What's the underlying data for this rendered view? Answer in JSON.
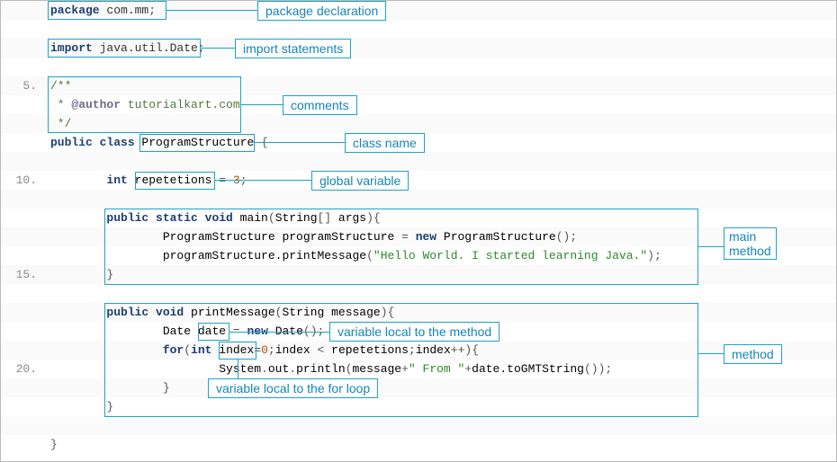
{
  "code": {
    "lines": [
      {
        "n": "",
        "tokens": [
          [
            "kw",
            "package"
          ],
          [
            "pkg",
            " com.mm"
          ],
          [
            "punct",
            ";"
          ]
        ]
      },
      {
        "n": "",
        "tokens": []
      },
      {
        "n": "",
        "tokens": [
          [
            "kw",
            "import"
          ],
          [
            "pkg",
            " java.util.Date"
          ],
          [
            "punct",
            ";"
          ]
        ]
      },
      {
        "n": "",
        "tokens": []
      },
      {
        "n": "5.",
        "tokens": [
          [
            "com",
            "/**"
          ]
        ]
      },
      {
        "n": "",
        "tokens": [
          [
            "com",
            " * "
          ],
          [
            "ann",
            "@author"
          ],
          [
            "com",
            " tutorialkart.com"
          ]
        ]
      },
      {
        "n": "",
        "tokens": [
          [
            "com",
            " */"
          ]
        ]
      },
      {
        "n": "",
        "tokens": [
          [
            "kw",
            "public "
          ],
          [
            "kw",
            "class "
          ],
          [
            "cls",
            "ProgramStructure"
          ],
          [
            "punct",
            " {"
          ]
        ]
      },
      {
        "n": "",
        "tokens": []
      },
      {
        "n": "10.",
        "tokens": [
          [
            "id",
            "        "
          ],
          [
            "kw",
            "int "
          ],
          [
            "id",
            "repetetions"
          ],
          [
            "punct",
            " = "
          ],
          [
            "num",
            "3"
          ],
          [
            "punct",
            ";"
          ]
        ]
      },
      {
        "n": "",
        "tokens": []
      },
      {
        "n": "",
        "tokens": [
          [
            "id",
            "        "
          ],
          [
            "kw",
            "public "
          ],
          [
            "kw",
            "static "
          ],
          [
            "kw",
            "void "
          ],
          [
            "id",
            "main"
          ],
          [
            "punct",
            "("
          ],
          [
            "cls",
            "String"
          ],
          [
            "punct",
            "[] "
          ],
          [
            "id",
            "args"
          ],
          [
            "punct",
            "){"
          ]
        ]
      },
      {
        "n": "",
        "tokens": [
          [
            "id",
            "                "
          ],
          [
            "cls",
            "ProgramStructure"
          ],
          [
            "id",
            " programStructure"
          ],
          [
            "punct",
            " = "
          ],
          [
            "kw",
            "new "
          ],
          [
            "cls",
            "ProgramStructure"
          ],
          [
            "punct",
            "();"
          ]
        ]
      },
      {
        "n": "",
        "tokens": [
          [
            "id",
            "                "
          ],
          [
            "id",
            "programStructure.printMessage"
          ],
          [
            "punct",
            "("
          ],
          [
            "str",
            "\"Hello World. I started learning Java.\""
          ],
          [
            "punct",
            ");"
          ]
        ]
      },
      {
        "n": "15.",
        "tokens": [
          [
            "id",
            "        "
          ],
          [
            "punct",
            "}"
          ]
        ]
      },
      {
        "n": "",
        "tokens": []
      },
      {
        "n": "",
        "tokens": [
          [
            "id",
            "        "
          ],
          [
            "kw",
            "public "
          ],
          [
            "kw",
            "void "
          ],
          [
            "id",
            "printMessage"
          ],
          [
            "punct",
            "("
          ],
          [
            "cls",
            "String"
          ],
          [
            "id",
            " message"
          ],
          [
            "punct",
            "){"
          ]
        ]
      },
      {
        "n": "",
        "tokens": [
          [
            "id",
            "                "
          ],
          [
            "cls",
            "Date "
          ],
          [
            "id",
            "date"
          ],
          [
            "punct",
            " = "
          ],
          [
            "kw",
            "new "
          ],
          [
            "cls",
            "Date"
          ],
          [
            "punct",
            "();"
          ]
        ]
      },
      {
        "n": "",
        "tokens": [
          [
            "id",
            "                "
          ],
          [
            "kw",
            "for"
          ],
          [
            "punct",
            "("
          ],
          [
            "kw",
            "int "
          ],
          [
            "id",
            "index"
          ],
          [
            "punct",
            "="
          ],
          [
            "num",
            "0"
          ],
          [
            "punct",
            ";"
          ],
          [
            "id",
            "index"
          ],
          [
            "punct",
            " < "
          ],
          [
            "id",
            "repetetions"
          ],
          [
            "punct",
            ";"
          ],
          [
            "id",
            "index"
          ],
          [
            "punct",
            "++){"
          ]
        ]
      },
      {
        "n": "20.",
        "tokens": [
          [
            "id",
            "                        "
          ],
          [
            "cls",
            "System"
          ],
          [
            "punct",
            "."
          ],
          [
            "id",
            "out"
          ],
          [
            "punct",
            "."
          ],
          [
            "id",
            "println"
          ],
          [
            "punct",
            "("
          ],
          [
            "id",
            "message"
          ],
          [
            "punct",
            "+"
          ],
          [
            "str",
            "\" From \""
          ],
          [
            "punct",
            "+"
          ],
          [
            "id",
            "date.toGMTString"
          ],
          [
            "punct",
            "());"
          ]
        ]
      },
      {
        "n": "",
        "tokens": [
          [
            "id",
            "                "
          ],
          [
            "punct",
            "}"
          ]
        ]
      },
      {
        "n": "",
        "tokens": [
          [
            "id",
            "        "
          ],
          [
            "punct",
            "}"
          ]
        ]
      },
      {
        "n": "",
        "tokens": []
      },
      {
        "n": "",
        "tokens": [
          [
            "punct",
            "}"
          ]
        ]
      }
    ]
  },
  "callouts": {
    "package_decl": "package declaration",
    "import_stmts": "import statements",
    "comments": "comments",
    "class_name": "class name",
    "global_var": "global variable",
    "main_method": "main method",
    "method": "method",
    "var_local_method": "variable local to the method",
    "var_local_for": "variable local to the for loop"
  }
}
